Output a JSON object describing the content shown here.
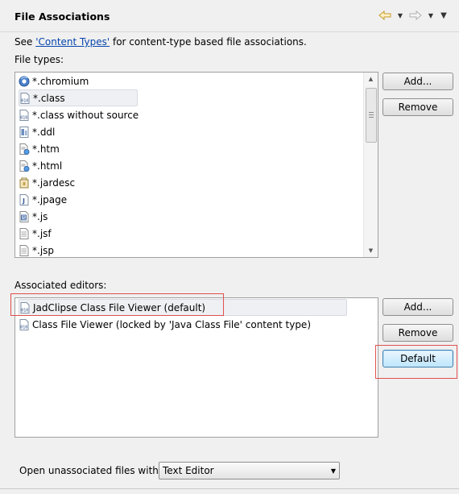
{
  "header": {
    "title": "File Associations"
  },
  "description": {
    "prefix": "See ",
    "link": "'Content Types'",
    "suffix": " for content-type based file associations."
  },
  "file_types": {
    "label": "File types:",
    "items": [
      {
        "label": "*.chromium",
        "icon": "chromium-icon"
      },
      {
        "label": "*.class",
        "icon": "class-file-icon"
      },
      {
        "label": "*.class without source",
        "icon": "class-file-icon"
      },
      {
        "label": "*.ddl",
        "icon": "ddl-file-icon"
      },
      {
        "label": "*.htm",
        "icon": "html-file-icon"
      },
      {
        "label": "*.html",
        "icon": "html-file-icon"
      },
      {
        "label": "*.jardesc",
        "icon": "jardesc-file-icon"
      },
      {
        "label": "*.jpage",
        "icon": "jpage-file-icon"
      },
      {
        "label": "*.js",
        "icon": "js-file-icon"
      },
      {
        "label": "*.jsf",
        "icon": "text-file-icon"
      },
      {
        "label": "*.jsp",
        "icon": "text-file-icon"
      }
    ],
    "selected": "*.class",
    "add_label": "Add...",
    "remove_label": "Remove"
  },
  "associated_editors": {
    "label": "Associated editors:",
    "items": [
      {
        "label": "JadClipse Class File Viewer (default)",
        "icon": "class-file-icon"
      },
      {
        "label": "Class File Viewer (locked by 'Java Class File' content type)",
        "icon": "class-file-icon"
      }
    ],
    "selected": "JadClipse Class File Viewer (default)",
    "add_label": "Add...",
    "remove_label": "Remove",
    "default_label": "Default"
  },
  "unassociated": {
    "label": "Open unassociated files with:",
    "value": "Text Editor"
  },
  "colors": {
    "link": "#0645ad",
    "highlight": "#e05050",
    "default_button": "#bee6fd"
  }
}
